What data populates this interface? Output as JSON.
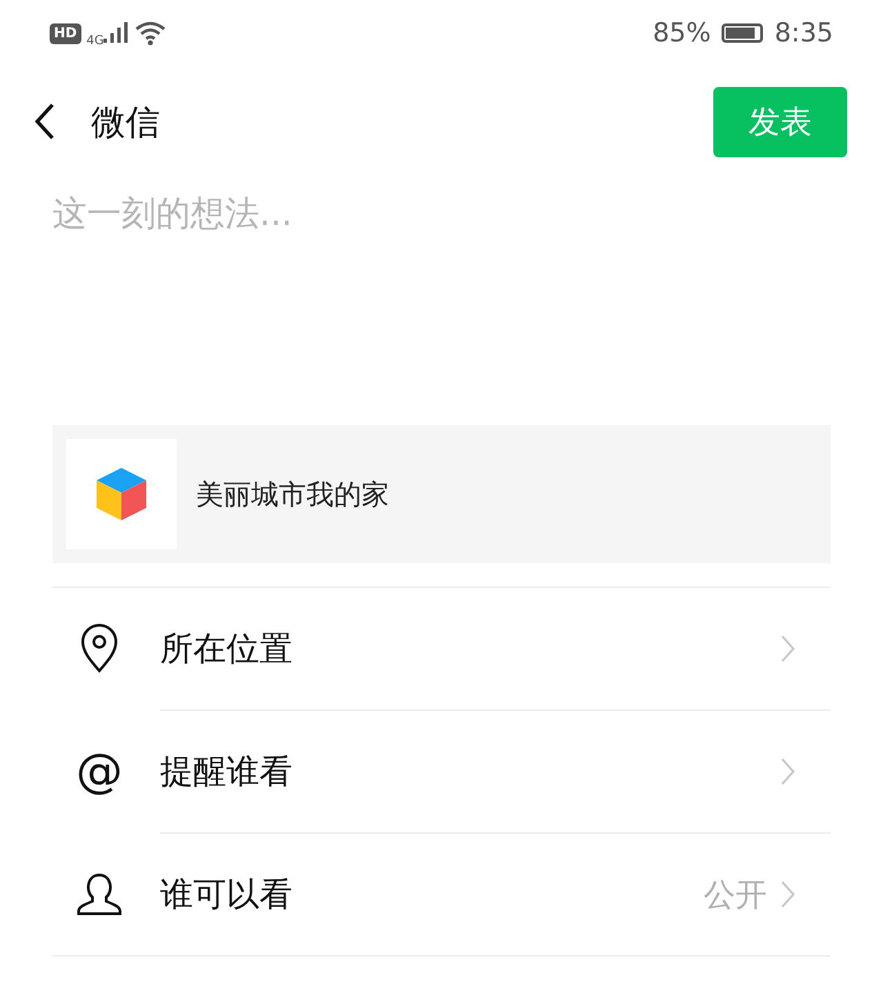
{
  "status_bar": {
    "network_badge": "HD",
    "network_type": "4G",
    "battery": "85%",
    "time": "8:35"
  },
  "header": {
    "title": "微信",
    "publish_button": "发表"
  },
  "compose": {
    "placeholder": "这一刻的想法..."
  },
  "link_card": {
    "title": "美丽城市我的家"
  },
  "options": [
    {
      "kind": "location",
      "label": "所在位置"
    },
    {
      "kind": "mention",
      "icon_char": "@",
      "label": "提醒谁看"
    },
    {
      "kind": "audience",
      "label": "谁可以看",
      "value": "公开"
    }
  ]
}
